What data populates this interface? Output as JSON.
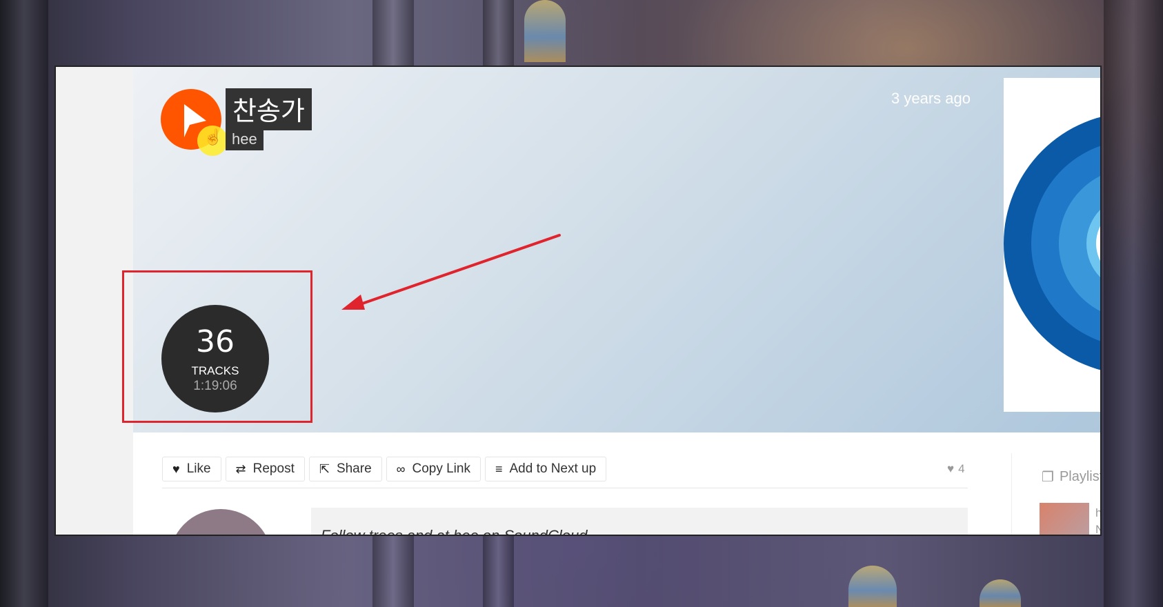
{
  "playlist": {
    "title": "찬송가",
    "username": "hee",
    "posted": "3 years ago",
    "track_count": "36",
    "track_label": "TRACKS",
    "duration": "1:19:06"
  },
  "actions": {
    "like": "Like",
    "repost": "Repost",
    "share": "Share",
    "copy_link": "Copy Link",
    "add_next": "Add to Next up"
  },
  "stats": {
    "likes": "4"
  },
  "description": "Follow trees and at hee on SoundCloud",
  "sidebar": {
    "heading": "Playlist",
    "item_user": "he",
    "item_title": "N"
  },
  "colors": {
    "brand": "#ff5500",
    "annotation": "#e0242d",
    "art_rings": [
      "#0a5aa8",
      "#1f78c8",
      "#3a98da",
      "#6ec5ef"
    ]
  },
  "icons": {
    "like": "heart-icon",
    "repost": "repost-icon",
    "share": "share-icon",
    "copy_link": "link-icon",
    "add_next": "queue-icon",
    "playlist": "playlist-icon"
  }
}
